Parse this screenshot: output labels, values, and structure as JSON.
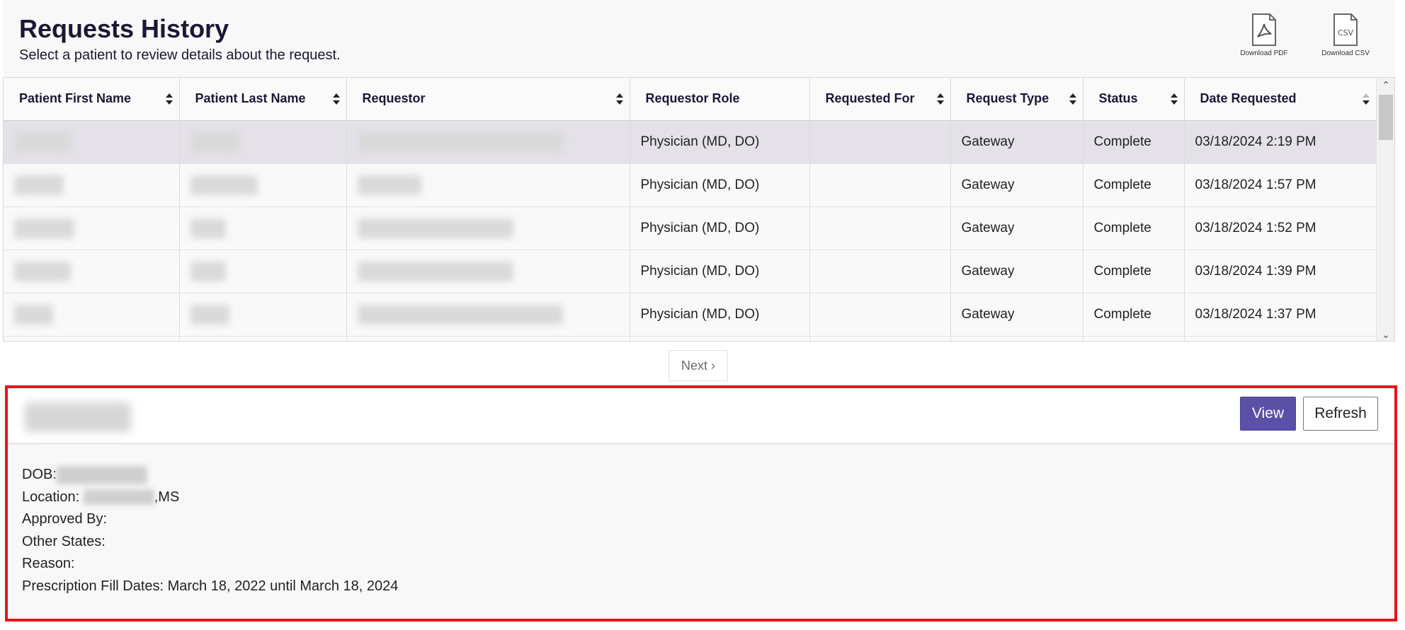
{
  "header": {
    "title": "Requests History",
    "subtitle": "Select a patient to review details about the request.",
    "download_pdf": "Download PDF",
    "download_csv": "Download CSV"
  },
  "table": {
    "columns": [
      "Patient First Name",
      "Patient Last Name",
      "Requestor",
      "Requestor Role",
      "Requested For",
      "Request Type",
      "Status",
      "Date Requested"
    ],
    "rows": [
      {
        "role": "Physician (MD, DO)",
        "type": "Gateway",
        "status": "Complete",
        "date": "03/18/2024 2:19 PM"
      },
      {
        "role": "Physician (MD, DO)",
        "type": "Gateway",
        "status": "Complete",
        "date": "03/18/2024 1:57 PM"
      },
      {
        "role": "Physician (MD, DO)",
        "type": "Gateway",
        "status": "Complete",
        "date": "03/18/2024 1:52 PM"
      },
      {
        "role": "Physician (MD, DO)",
        "type": "Gateway",
        "status": "Complete",
        "date": "03/18/2024 1:39 PM"
      },
      {
        "role": "Physician (MD, DO)",
        "type": "Gateway",
        "status": "Complete",
        "date": "03/18/2024 1:37 PM"
      }
    ]
  },
  "pagination": {
    "next_label": "Next ›"
  },
  "detail": {
    "view_label": "View",
    "refresh_label": "Refresh",
    "dob_label": "DOB:",
    "location_label": "Location: ",
    "location_state": ",MS",
    "approved_by_label": "Approved By:",
    "other_states_label": "Other States:",
    "reason_label": "Reason:",
    "fill_dates": "Prescription Fill Dates: March 18, 2022 until March 18, 2024"
  },
  "colors": {
    "accent": "#5b50a8",
    "highlight_border": "#e8141b",
    "selected_row": "#e4e1e8",
    "title_text": "#1d1635"
  }
}
